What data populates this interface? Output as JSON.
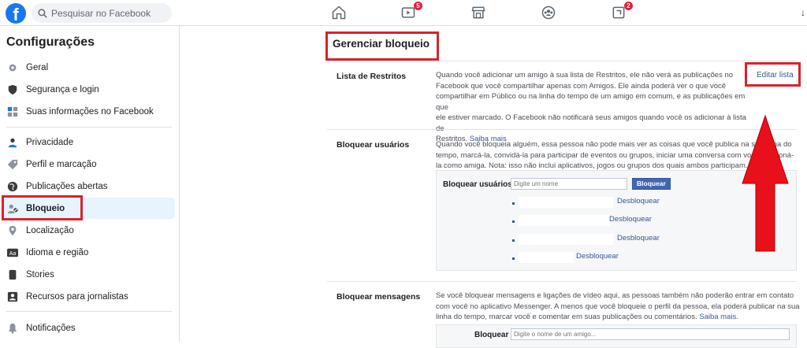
{
  "topbar": {
    "logo": "f",
    "search_placeholder": "Pesquisar no Facebook",
    "icons": [
      "home-icon",
      "watch-icon",
      "marketplace-icon",
      "groups-icon",
      "gaming-icon"
    ],
    "watch_badge": "5",
    "gaming_badge": "2",
    "corner_glyph": "↓"
  },
  "sidebar": {
    "title": "Configurações",
    "items": [
      {
        "label": "Geral",
        "icon": "gear-icon"
      },
      {
        "label": "Segurança e login",
        "icon": "shield-icon"
      },
      {
        "label": "Suas informações no Facebook",
        "icon": "info-grid-icon"
      },
      {
        "label": "Privacidade",
        "icon": "lock-icon"
      },
      {
        "label": "Perfil e marcação",
        "icon": "tag-icon"
      },
      {
        "label": "Publicações abertas",
        "icon": "globe-icon"
      },
      {
        "label": "Bloqueio",
        "icon": "user-block-icon"
      },
      {
        "label": "Localização",
        "icon": "location-pin-icon"
      },
      {
        "label": "Idioma e região",
        "icon": "language-icon"
      },
      {
        "label": "Stories",
        "icon": "stories-icon"
      },
      {
        "label": "Recursos para jornalistas",
        "icon": "journalist-icon"
      },
      {
        "label": "Notificações",
        "icon": "bell-icon"
      }
    ],
    "active": "Bloqueio"
  },
  "main": {
    "title": "Gerenciar bloqueio",
    "restricted": {
      "label": "Lista de Restritos",
      "lines": [
        "Quando você adicionar um amigo à sua lista de Restritos, ele não verá as publicações no",
        "Facebook que você compartilhar apenas com Amigos. Ele ainda poderá ver o que você",
        "compartilhar em Público ou na linha do tempo de um amigo em comum, e as publicações em que",
        "ele estiver marcado. O Facebook não notificará seus amigos quando você os adicionar à lista de",
        "Restritos."
      ],
      "learn_more": "Saiba mais",
      "edit_link": "Editar lista"
    },
    "block_users": {
      "label": "Bloquear usuários",
      "lines": [
        "Quando você bloqueia alguém, essa pessoa não pode mais ver as coisas que você publica na sua linha do",
        "tempo, marcá-la, convidá-la para participar de eventos ou grupos, iniciar uma conversa com você, adicioná-",
        "la como amiga. Nota: isso não inclui aplicativos, jogos ou grupos dos quais ambos participam."
      ],
      "field_label": "Bloquear usuários",
      "input_placeholder": "Digite um nome",
      "button": "Bloquear",
      "unblock_label": "Desbloquear",
      "blocked_count": 4
    },
    "block_messages": {
      "label": "Bloquear mensagens",
      "lines": [
        "Se você bloquear mensagens e ligações de vídeo aqui, as pessoas também não poderão entrar em contato",
        "com você no aplicativo Messenger. A menos que você bloqueie o perfil da pessoa, ela poderá publicar na sua",
        "linha do tempo, marcar você e comentar em suas publicações ou comentários."
      ],
      "learn_more": "Saiba mais.",
      "field_label": "Bloquear",
      "input_placeholder": "Digite o nome de um amigo..."
    }
  },
  "annotations": {
    "highlight_color": "#d8232a"
  }
}
